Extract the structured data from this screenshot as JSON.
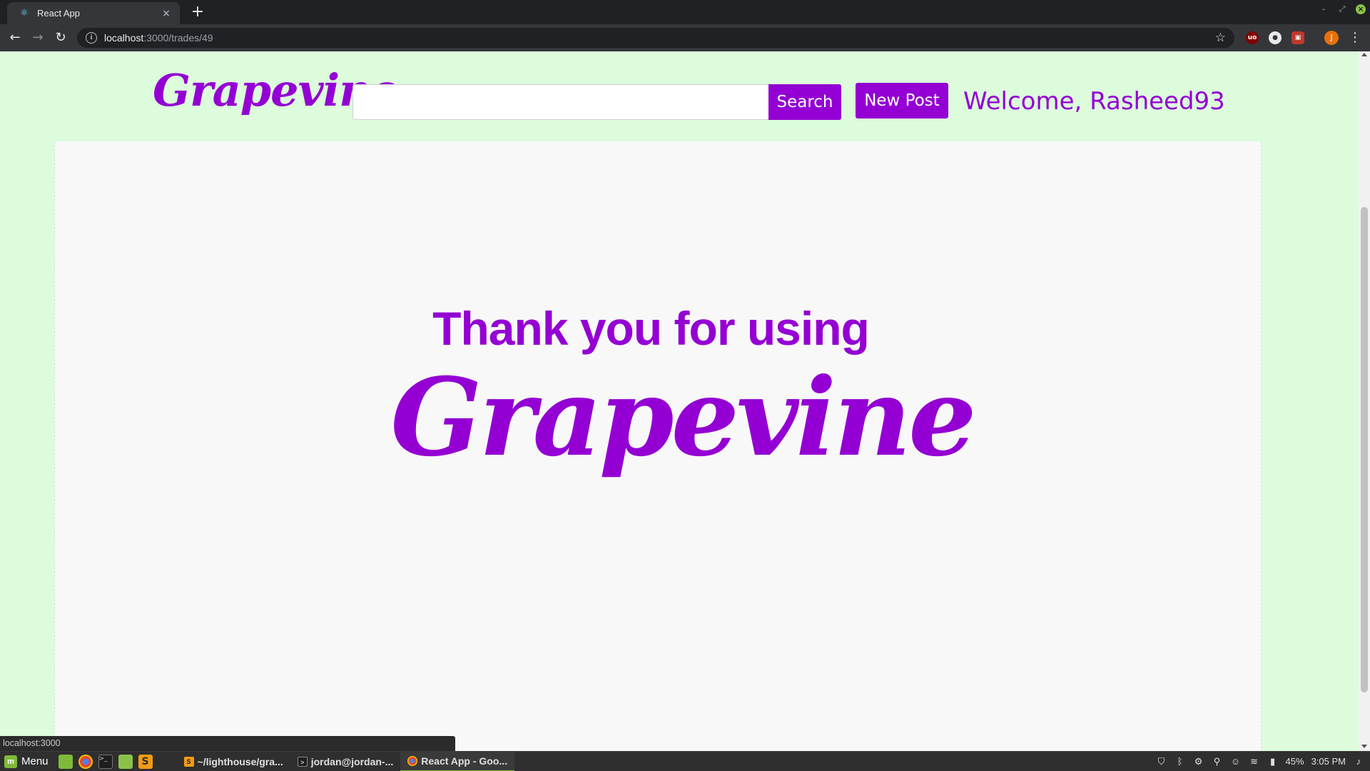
{
  "browser": {
    "tab_title": "React App",
    "tab_close": "×",
    "new_tab": "+",
    "url_host": "localhost",
    "url_path": ":3000/trades/49",
    "status_url": "localhost:3000",
    "profile_initial": "J"
  },
  "header": {
    "logo": "Grapevine",
    "search_value": "",
    "search_button": "Search",
    "new_post_button": "New Post",
    "welcome": "Welcome, Rasheed93"
  },
  "main": {
    "thanks_text": "Thank you for using",
    "brand": "Grapevine"
  },
  "taskbar": {
    "menu_label": "Menu",
    "windows": [
      {
        "label": "~/lighthouse/gra..."
      },
      {
        "label": "jordan@jordan-..."
      },
      {
        "label": "React App - Goo..."
      }
    ],
    "battery": "45%",
    "clock": "3:05 PM"
  },
  "colors": {
    "brand_purple": "#9400d3",
    "page_bg": "#dcfcdc",
    "panel_bg": "#f8f8f8"
  }
}
